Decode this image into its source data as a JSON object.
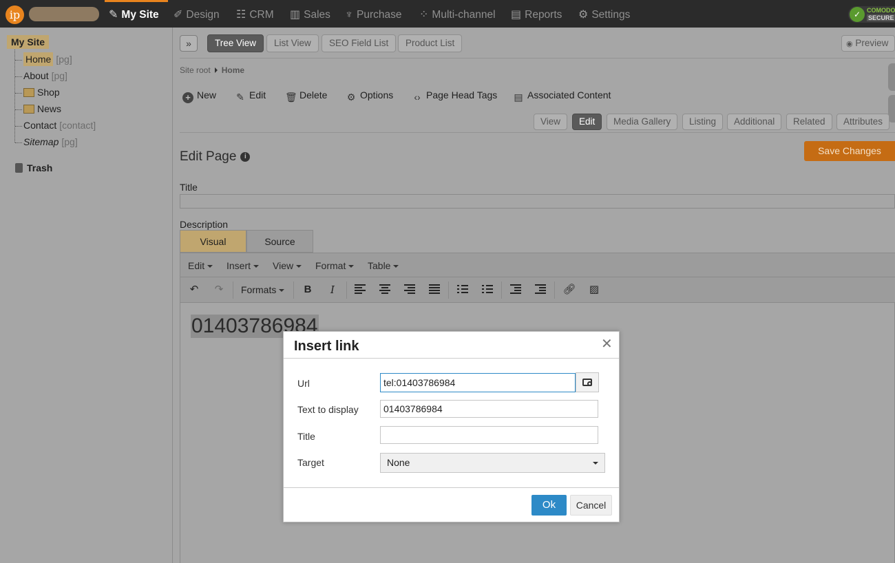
{
  "nav": {
    "logo": "ip",
    "items": [
      {
        "label": "My Site",
        "icon": "page-edit-icon"
      },
      {
        "label": "Design",
        "icon": "brush-icon"
      },
      {
        "label": "CRM",
        "icon": "contacts-icon"
      },
      {
        "label": "Sales",
        "icon": "sales-chart-icon"
      },
      {
        "label": "Purchase",
        "icon": "handshake-icon"
      },
      {
        "label": "Multi-channel",
        "icon": "network-icon"
      },
      {
        "label": "Reports",
        "icon": "bar-chart-icon"
      },
      {
        "label": "Settings",
        "icon": "gear-icon"
      }
    ],
    "badge": {
      "line1": "COMODO",
      "line2": "SECURE"
    }
  },
  "sidebar": {
    "root": "My Site",
    "items": [
      {
        "label": "Home",
        "tag": "[pg]"
      },
      {
        "label": "About",
        "tag": "[pg]"
      },
      {
        "label": "Shop",
        "tag": ""
      },
      {
        "label": "News",
        "tag": ""
      },
      {
        "label": "Contact",
        "tag": "[contact]"
      },
      {
        "label": "Sitemap",
        "tag": "[pg]"
      }
    ],
    "trash": "Trash"
  },
  "main": {
    "view_tabs": [
      "Tree View",
      "List View",
      "SEO Field List",
      "Product List"
    ],
    "preview": "Preview",
    "breadcrumb": {
      "root": "Site root",
      "current": "Home"
    },
    "actions": [
      "New",
      "Edit",
      "Delete",
      "Options",
      "Page Head Tags",
      "Associated Content"
    ],
    "edit_tabs": [
      "View",
      "Edit",
      "Media Gallery",
      "Listing",
      "Additional",
      "Related",
      "Attributes"
    ],
    "save": "Save Changes",
    "page_title": "Edit Page",
    "title_label": "Title",
    "description_label": "Description",
    "editor_tabs": [
      "Visual",
      "Source"
    ],
    "menus": [
      "Edit",
      "Insert",
      "View",
      "Format",
      "Table"
    ],
    "formats": "Formats",
    "content": "01403786984"
  },
  "modal": {
    "title": "Insert link",
    "url_label": "Url",
    "url_value": "tel:01403786984",
    "text_label": "Text to display",
    "text_value": "01403786984",
    "title_label": "Title",
    "title_value": "",
    "target_label": "Target",
    "target_value": "None",
    "ok": "Ok",
    "cancel": "Cancel"
  }
}
